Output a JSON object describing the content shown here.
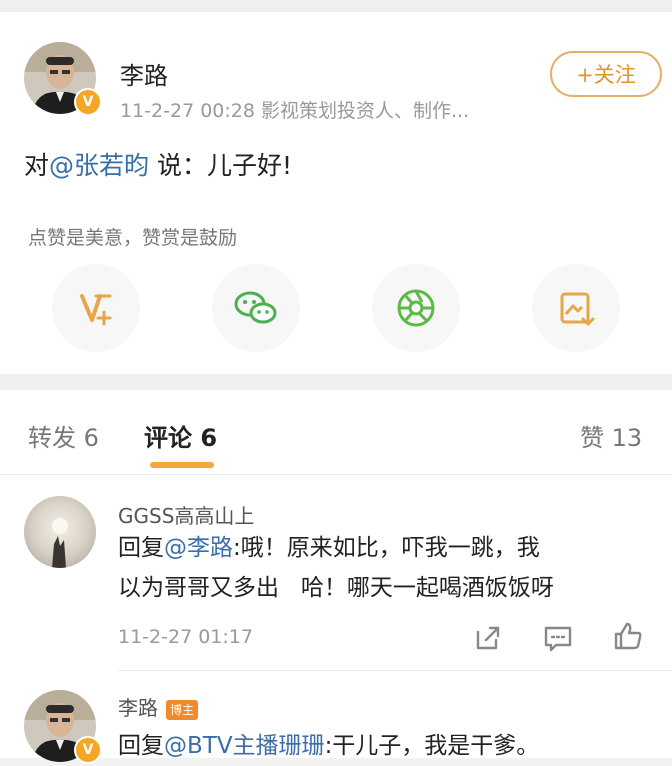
{
  "post": {
    "author": "李路",
    "meta": "11-2-27 00:28  影视策划投资人、制作...",
    "follow_label": "+关注",
    "text_prefix": "对",
    "mention": "@张若昀",
    "text_suffix": " 说：儿子好!",
    "reward_hint": "点赞是美意，赞赏是鼓励",
    "share_icons": [
      "reward-v-icon",
      "wechat-icon",
      "moments-icon",
      "save-image-icon"
    ]
  },
  "tabs": {
    "repost": "转发 6",
    "comment": "评论 6",
    "like": "赞 13"
  },
  "comments": [
    {
      "name": "GGSS高高山上",
      "reply_prefix": "回复",
      "mention": "@李路",
      "line1_rest": ":哦！原来如比，吓我一跳，我",
      "line2": "以为哥哥又多出   哈！哪天一起喝酒饭饭呀",
      "time": "11-2-27 01:17"
    },
    {
      "name": "李路",
      "badge": "博主",
      "reply_prefix": "回复",
      "mention": "@BTV主播珊珊",
      "line1_rest": ":干儿子，我是干爹。"
    }
  ],
  "colors": {
    "accent": "#f2a83a",
    "link": "#3a6ea8",
    "follow": "#e0952b"
  }
}
